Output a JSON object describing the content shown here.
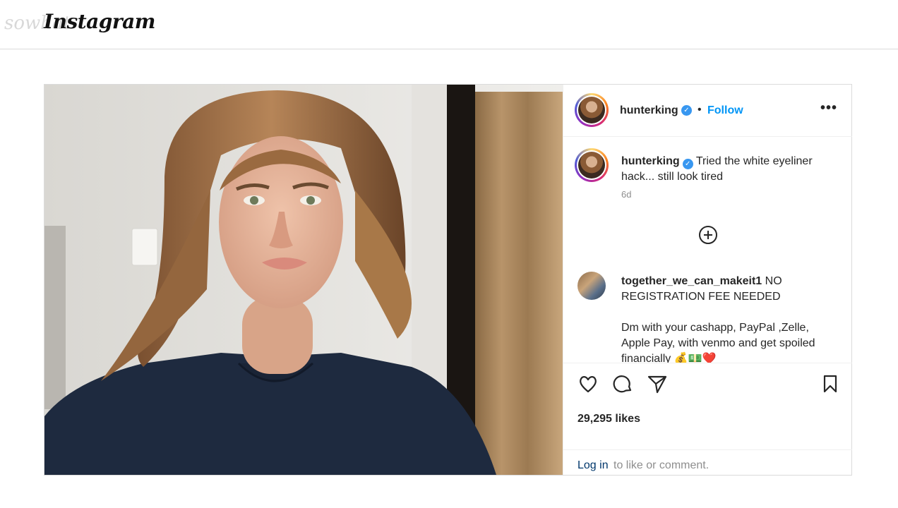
{
  "site": {
    "logo": "Instagram",
    "watermark": "sowhat"
  },
  "post": {
    "image_alt": "selfie photo",
    "author": {
      "username": "hunterking",
      "verified": true
    },
    "header": {
      "separator": "•",
      "follow_label": "Follow",
      "more_label": "•••"
    },
    "caption": {
      "username": "hunterking",
      "text": "Tried the white eyeliner hack... still look tired",
      "time": "6d"
    },
    "comments": [
      {
        "username": "together_we_can_makeit1",
        "text_line1": "NO REGISTRATION FEE NEEDED",
        "text_line2": "Dm with your cashapp, PayPal ,Zelle, Apple Pay, with venmo and get spoiled financially 💰💵❤️"
      }
    ],
    "likes": "29,295 likes",
    "login": {
      "link": "Log in",
      "rest": "to like or comment."
    }
  },
  "icons": {
    "verified": "verified-badge-icon",
    "load_more": "plus-circle-icon",
    "like": "heart-icon",
    "comment": "comment-bubble-icon",
    "share": "paper-plane-icon",
    "save": "bookmark-icon"
  },
  "colors": {
    "follow": "#0095f6",
    "verified": "#3897f0",
    "muted": "#8e8e8e",
    "link": "#00376b"
  }
}
